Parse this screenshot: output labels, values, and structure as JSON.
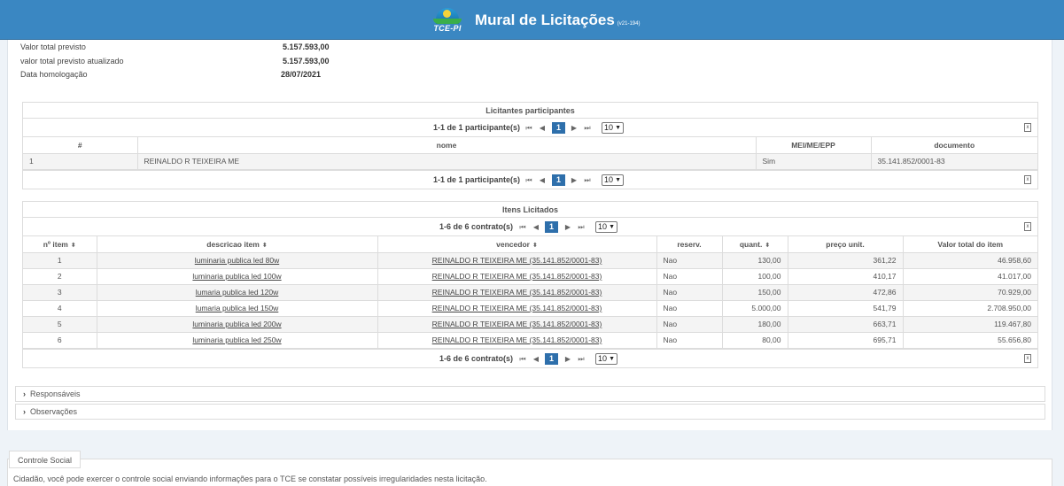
{
  "header": {
    "logo_text": "TCE-PI",
    "title": "Mural de Licitações",
    "version": "(v21-194)"
  },
  "info": [
    {
      "label": "Valor total previsto",
      "value": "5.157.593,00"
    },
    {
      "label": "valor total previsto atualizado",
      "value": "5.157.593,00"
    },
    {
      "label": "Data homologação",
      "value": "28/07/2021"
    }
  ],
  "licitantes": {
    "title": "Licitantes participantes",
    "pager_info": "1-1 de 1 participante(s)",
    "page": "1",
    "page_size": "10",
    "columns": [
      "#",
      "nome",
      "MEI/ME/EPP",
      "documento"
    ],
    "rows": [
      [
        "1",
        "REINALDO R TEIXEIRA ME",
        "Sim",
        "35.141.852/0001-83"
      ]
    ]
  },
  "itens": {
    "title": "Itens Licitados",
    "pager_info": "1-6 de 6 contrato(s)",
    "page": "1",
    "page_size": "10",
    "columns": [
      "nº item",
      "descricao item",
      "vencedor",
      "reserv.",
      "quant.",
      "preço unit.",
      "Valor total do item"
    ],
    "rows": [
      [
        "1",
        "luminaria publica led 80w",
        "REINALDO R TEIXEIRA ME (35.141.852/0001-83)",
        "Nao",
        "130,00",
        "361,22",
        "46.958,60"
      ],
      [
        "2",
        "luminaria publica led 100w",
        "REINALDO R TEIXEIRA ME (35.141.852/0001-83)",
        "Nao",
        "100,00",
        "410,17",
        "41.017,00"
      ],
      [
        "3",
        "lumaria publica led 120w",
        "REINALDO R TEIXEIRA ME (35.141.852/0001-83)",
        "Nao",
        "150,00",
        "472,86",
        "70.929,00"
      ],
      [
        "4",
        "lumaria publica led 150w",
        "REINALDO R TEIXEIRA ME (35.141.852/0001-83)",
        "Nao",
        "5.000,00",
        "541,79",
        "2.708.950,00"
      ],
      [
        "5",
        "luminaria publica led 200w",
        "REINALDO R TEIXEIRA ME (35.141.852/0001-83)",
        "Nao",
        "180,00",
        "663,71",
        "119.467,80"
      ],
      [
        "6",
        "luminaria publica led 250w",
        "REINALDO R TEIXEIRA ME (35.141.852/0001-83)",
        "Nao",
        "80,00",
        "695,71",
        "55.656,80"
      ]
    ]
  },
  "sections": {
    "responsaveis": "Responsáveis",
    "observacoes": "Observações"
  },
  "controle_social": {
    "tab": "Controle Social",
    "text": "Cidadão, você pode exercer o controle social enviando informações para o TCE se constatar possíveis irregularidades nesta licitação."
  },
  "icons": {
    "pager_first": "first-page-icon",
    "pager_prev": "prev-page-icon",
    "pager_next": "next-page-icon",
    "pager_last": "last-page-icon",
    "export": "export-excel-icon",
    "sort": "sort-icon",
    "chevron": "chevron-right-icon"
  },
  "colors": {
    "header_bg": "#3a87c2",
    "page_active": "#2e6fab"
  }
}
